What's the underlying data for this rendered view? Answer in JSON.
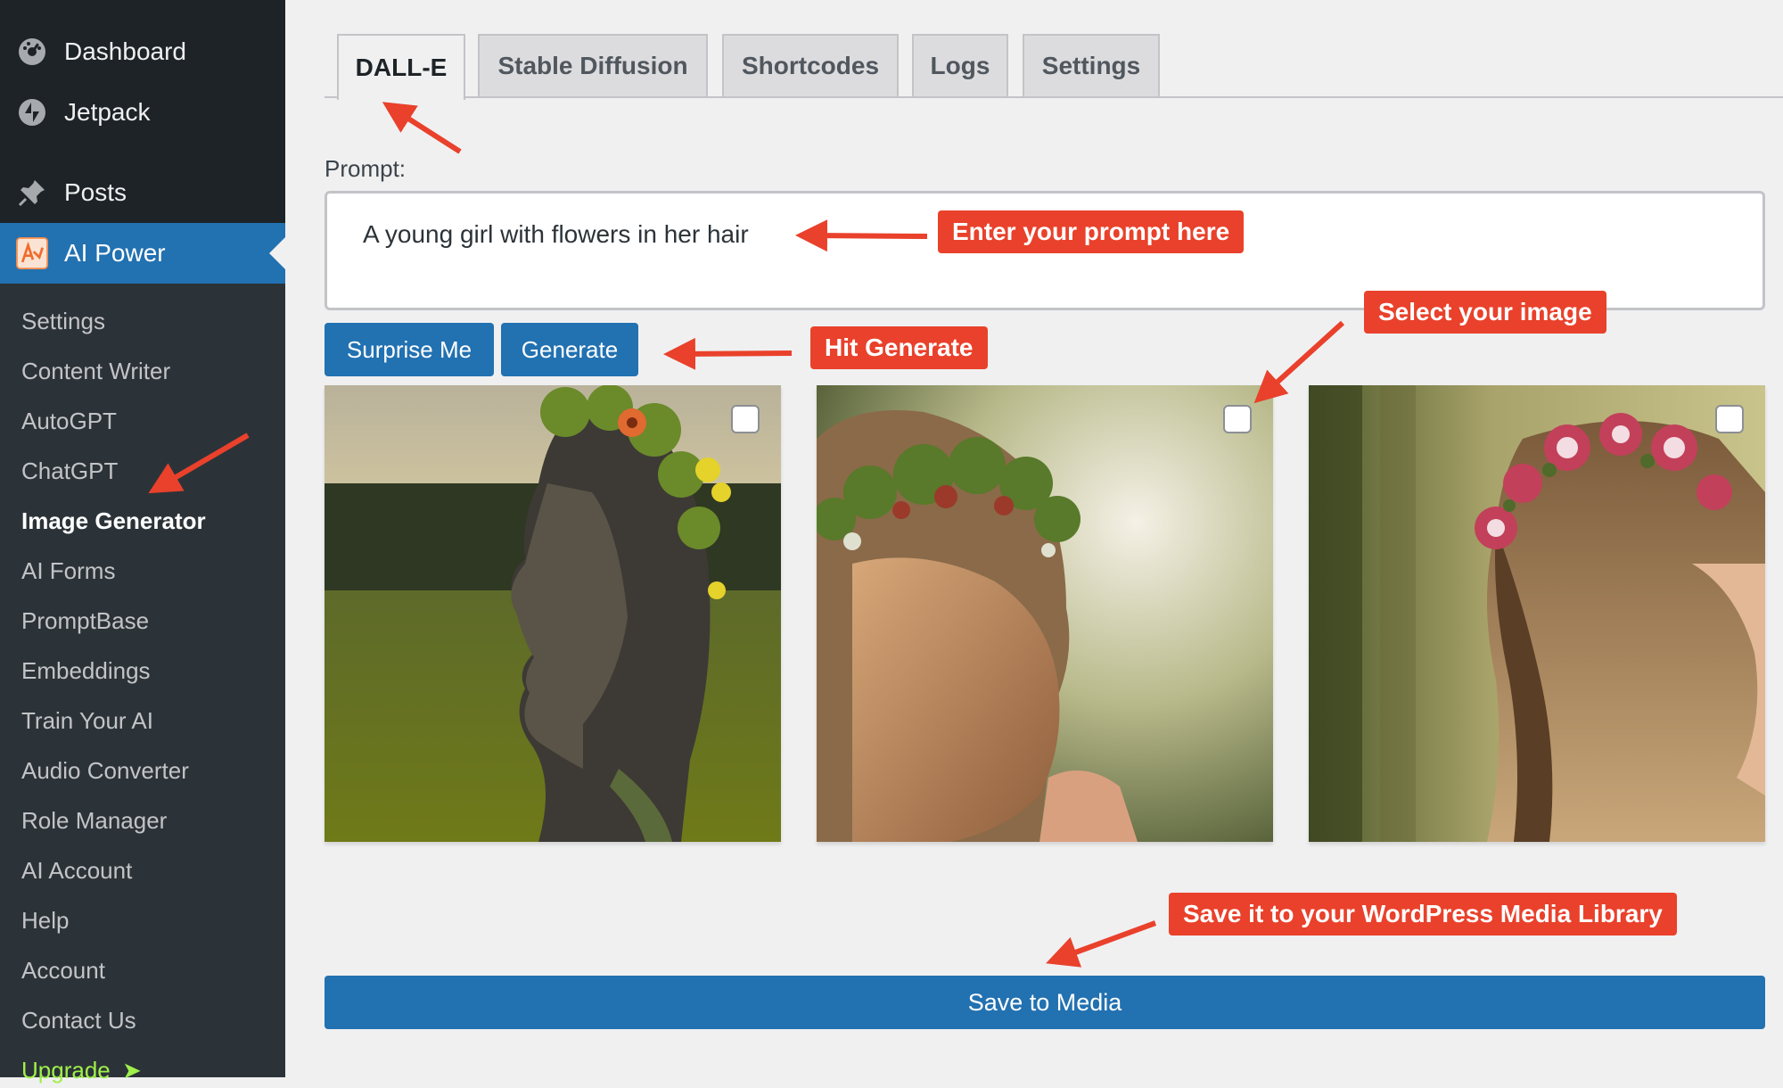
{
  "sidebar": {
    "top_items": [
      {
        "label": "Dashboard",
        "icon": "dashboard-gauge-icon"
      },
      {
        "label": "Jetpack",
        "icon": "jetpack-bolt-icon"
      },
      {
        "label": "Posts",
        "icon": "pushpin-icon"
      },
      {
        "label": "AI Power",
        "icon": "ai-power-logo-icon",
        "active": true
      }
    ],
    "submenu": [
      {
        "label": "Settings"
      },
      {
        "label": "Content Writer"
      },
      {
        "label": "AutoGPT"
      },
      {
        "label": "ChatGPT"
      },
      {
        "label": "Image Generator",
        "current": true
      },
      {
        "label": "AI Forms"
      },
      {
        "label": "PromptBase"
      },
      {
        "label": "Embeddings"
      },
      {
        "label": "Train Your AI"
      },
      {
        "label": "Audio Converter"
      },
      {
        "label": "Role Manager"
      },
      {
        "label": "AI Account"
      },
      {
        "label": "Help"
      },
      {
        "label": "Account"
      },
      {
        "label": "Contact Us"
      },
      {
        "label": "Upgrade",
        "suffix": "➤",
        "color": "#9ff04a"
      }
    ]
  },
  "tabs": [
    {
      "label": "DALL-E",
      "active": true
    },
    {
      "label": "Stable Diffusion"
    },
    {
      "label": "Shortcodes"
    },
    {
      "label": "Logs"
    },
    {
      "label": "Settings"
    }
  ],
  "form": {
    "prompt_label": "Prompt:",
    "prompt_value": "A young girl with flowers in her hair",
    "surprise_button": "Surprise Me",
    "generate_button": "Generate",
    "save_button": "Save to Media"
  },
  "images": [
    {
      "checked": false
    },
    {
      "checked": false
    },
    {
      "checked": false
    }
  ],
  "annotations": {
    "prompt_hint": "Enter your prompt here",
    "generate_hint": "Hit Generate",
    "select_hint": "Select your image",
    "save_hint": "Save it to your WordPress Media Library"
  },
  "colors": {
    "sidebar_bg": "#1d2327",
    "submenu_bg": "#2c3338",
    "accent_blue": "#2271b1",
    "annotation_red": "#e9412b",
    "upgrade_green": "#9ff04a"
  }
}
